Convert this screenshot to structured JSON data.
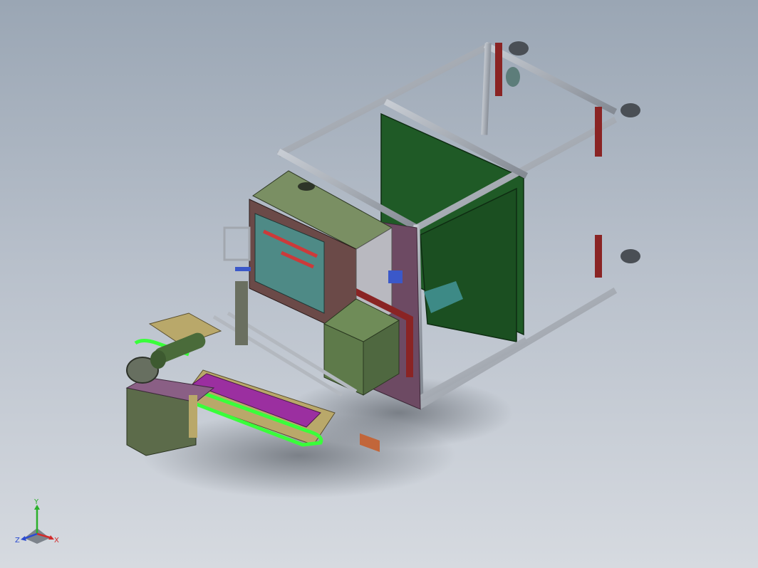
{
  "viewport": {
    "background_top": "#9aa6b4",
    "background_bottom": "#d6dae0"
  },
  "model": {
    "frame_color": "#9ea4ad",
    "panel_color": "#1f5a26",
    "housing_color": "#6a7d56",
    "conveyor_accent": "#9b2fa0",
    "highlight_green": "#39ff3a",
    "bracket_red": "#8a2424"
  },
  "triad": {
    "x_label": "X",
    "y_label": "Y",
    "z_label": "Z",
    "x_color": "#d12b2b",
    "y_color": "#2bb02b",
    "z_color": "#2b4bd1"
  }
}
